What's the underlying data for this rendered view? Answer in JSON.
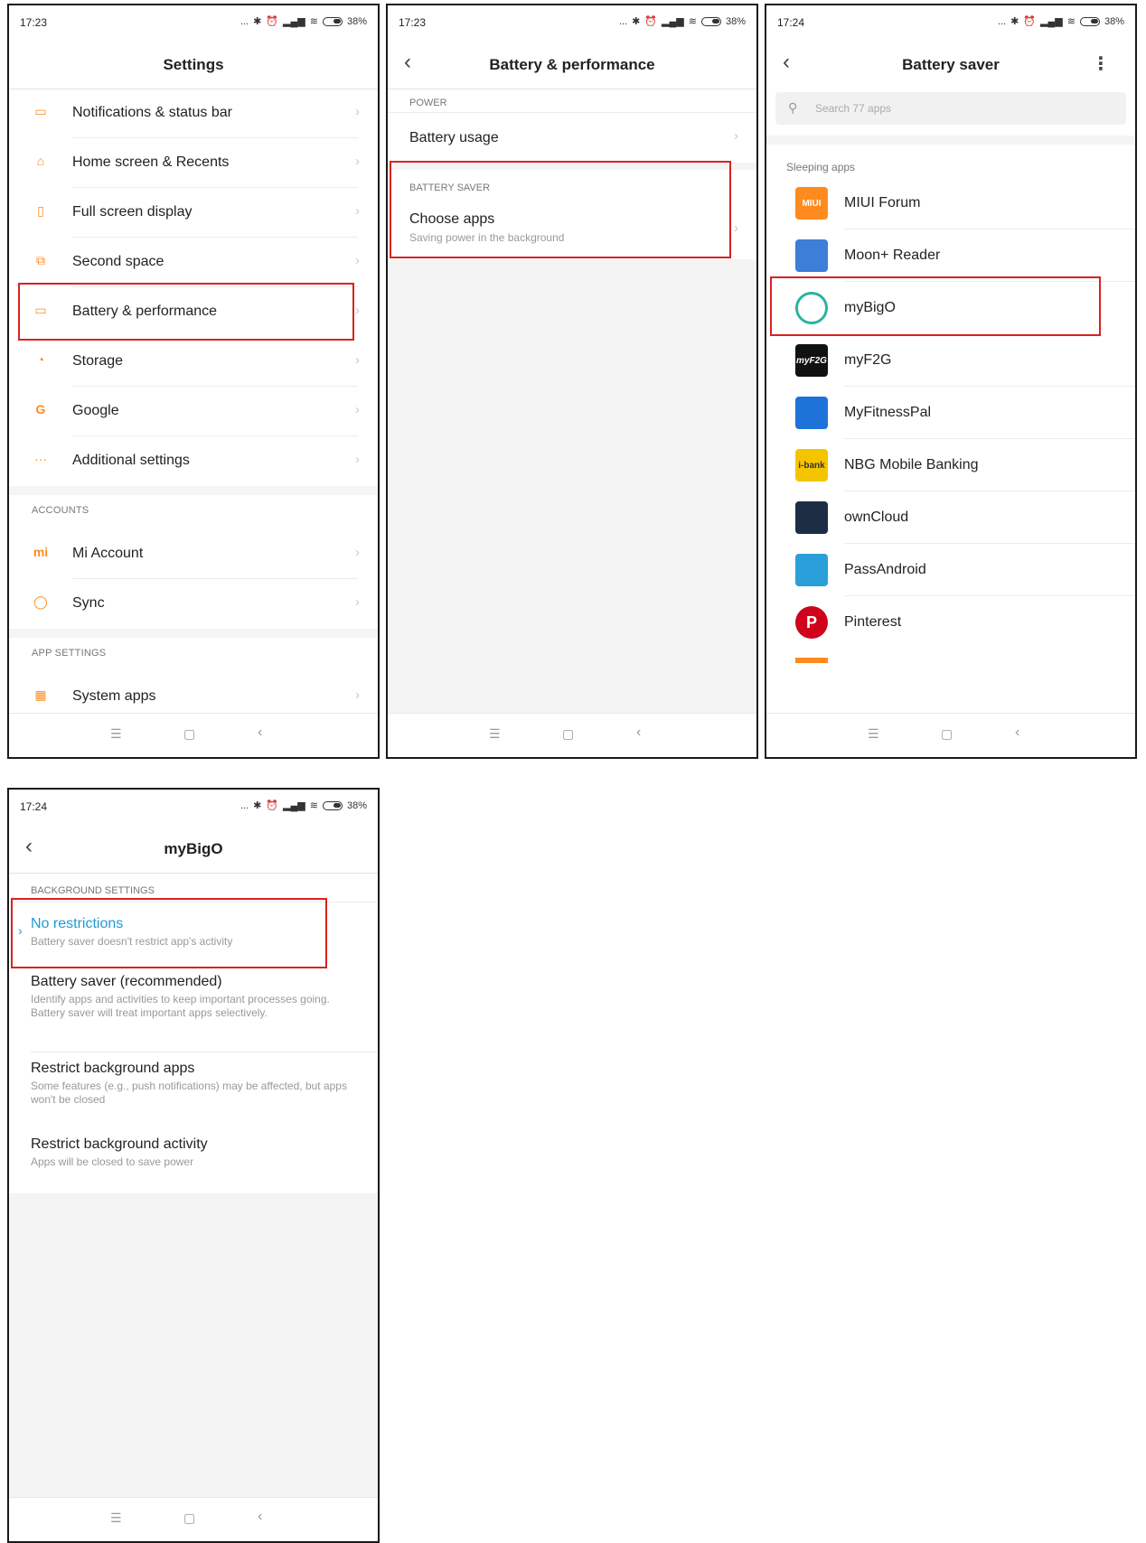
{
  "status": {
    "p1_time": "17:23",
    "p2_time": "17:23",
    "p3_time": "17:24",
    "p4_time": "17:24",
    "dots": "...",
    "battery_pct": "38%"
  },
  "settings": {
    "title": "Settings",
    "items": [
      {
        "label": "Notifications & status bar"
      },
      {
        "label": "Home screen & Recents"
      },
      {
        "label": "Full screen display"
      },
      {
        "label": "Second space"
      },
      {
        "label": "Battery & performance"
      },
      {
        "label": "Storage"
      },
      {
        "label": "Google"
      },
      {
        "label": "Additional settings"
      }
    ],
    "accounts_header": "ACCOUNTS",
    "accounts": [
      {
        "label": "Mi Account"
      },
      {
        "label": "Sync"
      }
    ],
    "app_settings_header": "APP SETTINGS",
    "app_settings": [
      {
        "label": "System apps"
      }
    ]
  },
  "battery_perf": {
    "title": "Battery & performance",
    "power_header": "POWER",
    "battery_usage": "Battery usage",
    "saver_header": "BATTERY SAVER",
    "choose_apps": "Choose apps",
    "choose_apps_sub": "Saving power in the background"
  },
  "battery_saver": {
    "title": "Battery saver",
    "search_placeholder": "Search 77 apps",
    "section": "Sleeping apps",
    "apps": [
      {
        "name": "MIUI Forum",
        "icon": "MIUI"
      },
      {
        "name": "Moon+ Reader",
        "icon": ""
      },
      {
        "name": "myBigO",
        "icon": ""
      },
      {
        "name": "myF2G",
        "icon": "myF2G"
      },
      {
        "name": "MyFitnessPal",
        "icon": ""
      },
      {
        "name": "NBG Mobile Banking",
        "icon": "i-bank"
      },
      {
        "name": "ownCloud",
        "icon": ""
      },
      {
        "name": "PassAndroid",
        "icon": ""
      },
      {
        "name": "Pinterest",
        "icon": "P"
      }
    ]
  },
  "mybigo": {
    "title": "myBigO",
    "header": "BACKGROUND SETTINGS",
    "options": [
      {
        "title": "No restrictions",
        "desc": "Battery saver doesn't restrict app's activity"
      },
      {
        "title": "Battery saver (recommended)",
        "desc1": "Identify apps and activities to keep important processes going.",
        "desc2": "Battery saver will treat important apps selectively."
      },
      {
        "title": "Restrict background apps",
        "desc": "Some features (e.g., push notifications) may be affected, but apps won't be closed"
      },
      {
        "title": "Restrict background activity",
        "desc": "Apps will be closed to save power"
      }
    ]
  },
  "colors": {
    "accent_orange": "#ff8a1e",
    "selected_blue": "#1e9ad6",
    "highlight_red": "#d8231f"
  },
  "icons": {
    "nav_menu": "menu-icon",
    "nav_home": "home-icon",
    "nav_back": "back-icon"
  }
}
